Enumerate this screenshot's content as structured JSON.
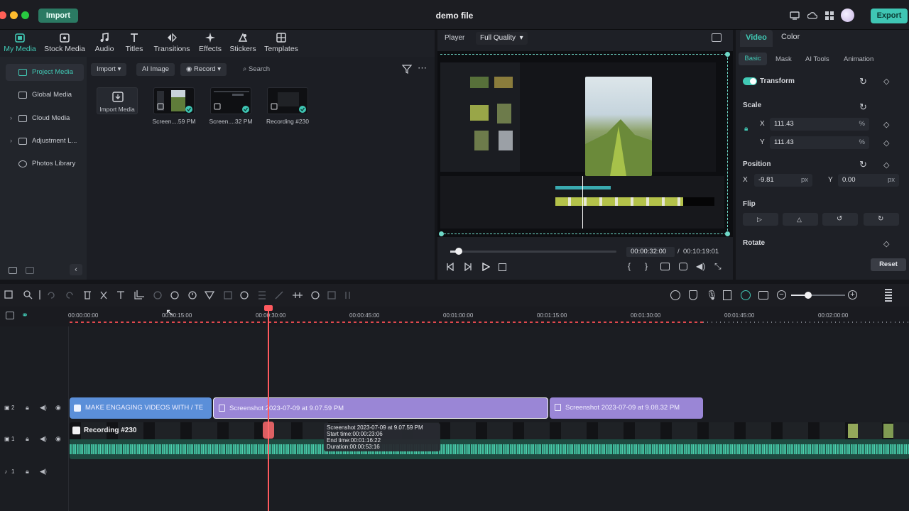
{
  "window": {
    "title": "demo file",
    "import_label": "Import",
    "export_label": "Export"
  },
  "media_tabs": [
    {
      "label": "My Media",
      "icon": "folder-media-icon"
    },
    {
      "label": "Stock Media",
      "icon": "stock-media-icon"
    },
    {
      "label": "Audio",
      "icon": "music-note-icon"
    },
    {
      "label": "Titles",
      "icon": "text-t-icon"
    },
    {
      "label": "Transitions",
      "icon": "transition-arrows-icon"
    },
    {
      "label": "Effects",
      "icon": "sparkle-icon"
    },
    {
      "label": "Stickers",
      "icon": "sticker-icon"
    },
    {
      "label": "Templates",
      "icon": "template-grid-icon"
    }
  ],
  "media_sidebar": [
    {
      "label": "Project Media"
    },
    {
      "label": "Global Media"
    },
    {
      "label": "Cloud Media"
    },
    {
      "label": "Adjustment L..."
    },
    {
      "label": "Photos Library"
    }
  ],
  "media_toolbar": {
    "import": "Import",
    "ai_image": "AI Image",
    "record": "Record",
    "search_placeholder": "Search"
  },
  "media_items": [
    {
      "label": "Import Media"
    },
    {
      "label": "Screen....59 PM"
    },
    {
      "label": "Screen....32 PM"
    },
    {
      "label": "Recording #230"
    }
  ],
  "player": {
    "tab": "Player",
    "quality": "Full Quality",
    "current_time": "00:00:32:00",
    "separator": "/",
    "total_time": "00:10:19:01"
  },
  "props": {
    "tabs": [
      "Video",
      "Color"
    ],
    "subtabs": [
      "Basic",
      "Mask",
      "AI Tools",
      "Animation"
    ],
    "transform": "Transform",
    "scale": {
      "label": "Scale",
      "x_label": "X",
      "x": "111.43",
      "y_label": "Y",
      "y": "111.43",
      "unit": "%"
    },
    "position": {
      "label": "Position",
      "x_label": "X",
      "x": "-9.81",
      "y_label": "Y",
      "y": "0.00",
      "unit": "px"
    },
    "flip": "Flip",
    "rotate": "Rotate",
    "reset": "Reset"
  },
  "timeline": {
    "ruler": [
      "00:00:00:00",
      "00:00:15:00",
      "00:00:30:00",
      "00:00:45:00",
      "00:01:00:00",
      "00:01:15:00",
      "00:01:30:00",
      "00:01:45:00",
      "00:02:00:00"
    ],
    "tracks": [
      {
        "label": "2"
      },
      {
        "label": "1"
      },
      {
        "label": "1"
      }
    ],
    "clips": {
      "title": "MAKE ENGAGING VIDEOS WITH / TE",
      "shot1": "Screenshot 2023-07-09 at 9.07.59 PM",
      "shot2": "Screenshot 2023-07-09 at 9.08.32 PM",
      "recording": "Recording #230"
    },
    "tooltip": [
      "Screenshot 2023-07-09 at 9.07.59 PM",
      "Start time:00:00:23:06",
      "End time:00:01:16:22",
      "Duration:00:00:53:16"
    ]
  },
  "colors": {
    "accent": "#41c9b5",
    "playhead": "#ff5a5f",
    "title_clip": "#5b8fd9",
    "image_clip": "#9a86d6",
    "audio_wave": "#3fb89a"
  }
}
